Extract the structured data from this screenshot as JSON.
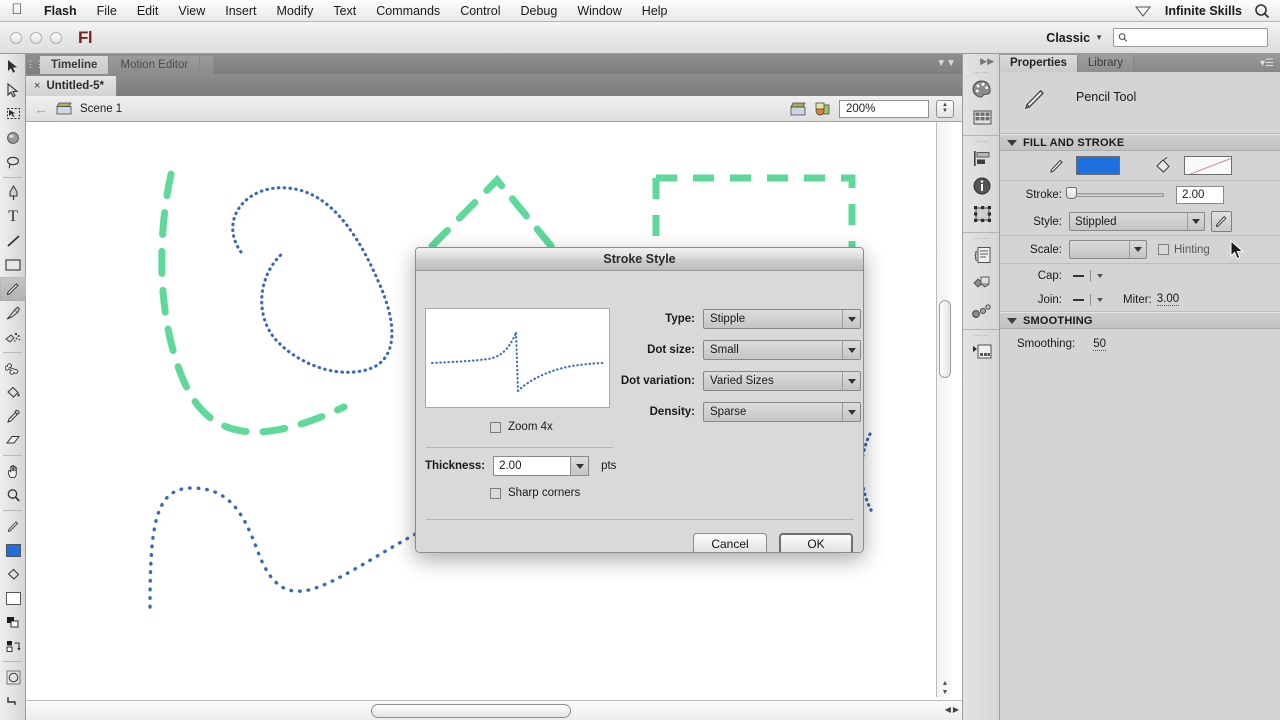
{
  "os_menu": {
    "apple_icon": "apple-logo-icon",
    "items": [
      "Flash",
      "File",
      "Edit",
      "View",
      "Insert",
      "Modify",
      "Text",
      "Commands",
      "Control",
      "Debug",
      "Window",
      "Help"
    ],
    "app_item": "Flash",
    "user": "Infinite Skills",
    "diamond_icon": "diamond-icon",
    "spotlight_icon": "search-icon"
  },
  "app_bar": {
    "logo": "Fl",
    "workspace": "Classic",
    "workspace_caret": "chevron-down-icon",
    "search_placeholder": "",
    "search_value": "",
    "search_icon": "search-icon"
  },
  "timeline": {
    "tabs": [
      {
        "label": "Timeline",
        "active": true
      },
      {
        "label": "Motion Editor",
        "active": false
      }
    ],
    "collapse_icon": "collapse-icon"
  },
  "document_tabs": [
    {
      "label": "Untitled-5*",
      "close": "×",
      "active": true
    }
  ],
  "edit_bar": {
    "back_arrow": "back-arrow-icon",
    "scene_icon": "scene-clapper-icon",
    "scene_label": "Scene 1",
    "symbol_icon": "edit-scene-icon",
    "symbol2_icon": "edit-symbols-icon",
    "zoom_value": "200%",
    "stepper_up": "▲",
    "stepper_down": "▼"
  },
  "tools": {
    "items": [
      {
        "name": "selection-tool",
        "glyph": "arrow"
      },
      {
        "name": "subselection-tool",
        "glyph": "arrow-hollow"
      },
      {
        "name": "free-transform-tool",
        "glyph": "transform"
      },
      {
        "name": "3d-rotation-tool",
        "glyph": "sphere"
      },
      {
        "name": "lasso-tool",
        "glyph": "lasso"
      },
      {
        "name": "pen-tool",
        "glyph": "pen"
      },
      {
        "name": "text-tool",
        "glyph": "T"
      },
      {
        "name": "line-tool",
        "glyph": "line"
      },
      {
        "name": "rectangle-tool",
        "glyph": "rect"
      },
      {
        "name": "pencil-tool",
        "glyph": "pencil",
        "selected": true
      },
      {
        "name": "brush-tool",
        "glyph": "brush"
      },
      {
        "name": "spray-brush-tool",
        "glyph": "spray"
      },
      {
        "name": "bone-tool",
        "glyph": "bone"
      },
      {
        "name": "paint-bucket-tool",
        "glyph": "bucket"
      },
      {
        "name": "eyedropper-tool",
        "glyph": "eyedropper"
      },
      {
        "name": "eraser-tool",
        "glyph": "eraser"
      },
      {
        "name": "hand-tool",
        "glyph": "hand"
      },
      {
        "name": "zoom-tool",
        "glyph": "magnifier"
      }
    ],
    "stroke_color_icon": "stroke-color-icon",
    "stroke_color": "#1f6fe0",
    "fill_color_icon": "fill-color-icon",
    "fill_color": "#ffffff",
    "bw_icon": "black-white-icon",
    "swap_icon": "swap-colors-icon",
    "object_drawing_icon": "object-drawing-icon",
    "smooth_icon": "smooth-option-icon"
  },
  "icon_dock": {
    "groups": [
      [
        "color-palette-icon",
        "swatches-icon"
      ],
      [
        "align-icon",
        "info-icon",
        "transform-icon"
      ],
      [
        "actions-icon",
        "components-icon",
        "motion-presets-icon"
      ],
      [
        "movie-explorer-icon"
      ]
    ]
  },
  "properties": {
    "tabs": [
      {
        "label": "Properties",
        "active": true
      },
      {
        "label": "Library",
        "active": false
      }
    ],
    "panel_menu_icon": "panel-menu-icon",
    "tool_icon": "pencil-tool-icon",
    "tool_name": "Pencil Tool",
    "fill_stroke": {
      "section_title": "FILL AND STROKE",
      "disclosure_icon": "triangle-down-icon",
      "stroke_color_icon": "stroke-pencil-icon",
      "stroke_color": "#1f6fe0",
      "fill_bucket_icon": "paint-bucket-icon",
      "fill_value": "None",
      "stroke_label": "Stroke:",
      "stroke_value": "2.00",
      "style_label": "Style:",
      "style_value": "Stippled",
      "style_edit_icon": "edit-stroke-style-icon",
      "scale_label": "Scale:",
      "scale_value": "",
      "hinting_label": "Hinting",
      "hinting_checked": false,
      "cap_label": "Cap:",
      "join_label": "Join:",
      "miter_label": "Miter:",
      "miter_value": "3.00"
    },
    "smoothing": {
      "section_title": "SMOOTHING",
      "disclosure_icon": "triangle-down-icon",
      "label": "Smoothing:",
      "value": "50"
    }
  },
  "dialog": {
    "title": "Stroke Style",
    "preview_name": "stroke-preview",
    "zoom_checkbox": {
      "label": "Zoom 4x",
      "checked": false
    },
    "fields": [
      {
        "label": "Type:",
        "value": "Stipple",
        "name": "type-select"
      },
      {
        "label": "Dot size:",
        "value": "Small",
        "name": "dot-size-select"
      },
      {
        "label": "Dot variation:",
        "value": "Varied Sizes",
        "name": "dot-variation-select"
      },
      {
        "label": "Density:",
        "value": "Sparse",
        "name": "density-select"
      }
    ],
    "thickness_label": "Thickness:",
    "thickness_value": "2.00",
    "thickness_units": "pts",
    "sharp_corners": {
      "label": "Sharp corners",
      "checked": false
    },
    "cancel_label": "Cancel",
    "ok_label": "OK"
  },
  "canvas": {
    "stroke_green": "#5fd99a",
    "stroke_blue": "#3b6bb5",
    "background": "#ffffff"
  }
}
